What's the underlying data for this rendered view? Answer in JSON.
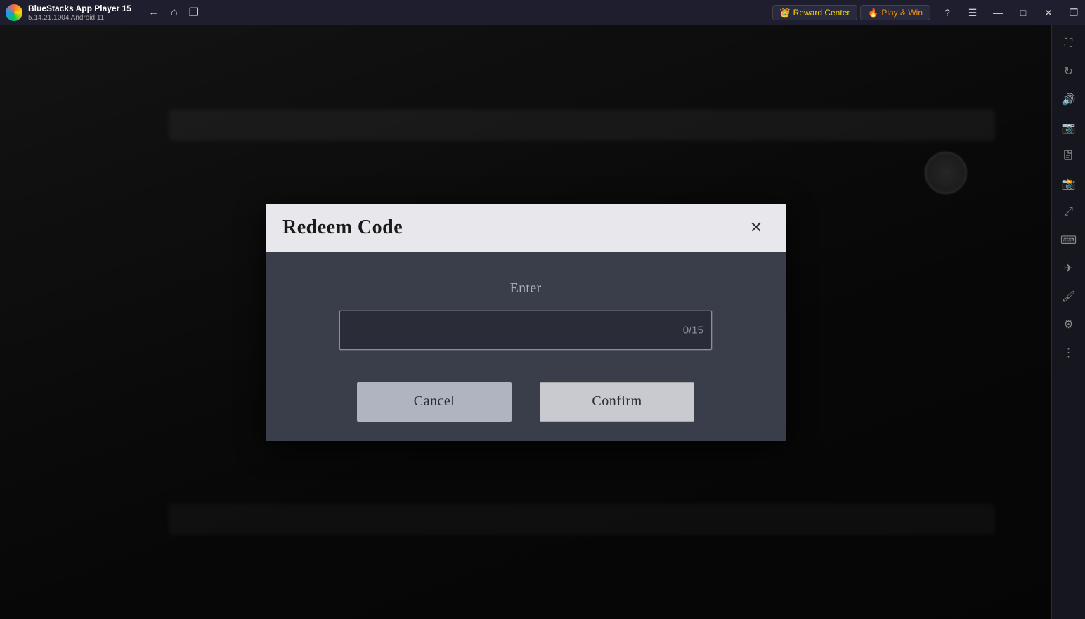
{
  "titlebar": {
    "app_name": "BlueStacks App Player 15",
    "version": "5.14.21.1004  Android 11",
    "reward_center_label": "Reward Center",
    "play_win_label": "Play & Win"
  },
  "nav_buttons": {
    "back": "←",
    "home": "⌂",
    "copy": "❐"
  },
  "window_controls": {
    "minimize": "—",
    "maximize": "□",
    "close": "✕",
    "restore": "❐"
  },
  "sidebar": {
    "icons": [
      {
        "name": "expand-icon",
        "symbol": "⛶"
      },
      {
        "name": "rotate-icon",
        "symbol": "↻"
      },
      {
        "name": "volume-icon",
        "symbol": "🔊"
      },
      {
        "name": "screenshot-icon",
        "symbol": "📷"
      },
      {
        "name": "apk-icon",
        "symbol": "📦"
      },
      {
        "name": "camera-icon",
        "symbol": "📸"
      },
      {
        "name": "resize-icon",
        "symbol": "⤢"
      },
      {
        "name": "keyboard-icon",
        "symbol": "⌨"
      },
      {
        "name": "airplane-icon",
        "symbol": "✈"
      },
      {
        "name": "brush-icon",
        "symbol": "🖌"
      },
      {
        "name": "settings-icon",
        "symbol": "⚙"
      },
      {
        "name": "more-icon",
        "symbol": "⋮"
      }
    ]
  },
  "modal": {
    "title": "Redeem Code",
    "close_label": "✕",
    "enter_label": "Enter",
    "input_placeholder": "",
    "input_counter": "0/15",
    "cancel_label": "Cancel",
    "confirm_label": "Confirm"
  }
}
